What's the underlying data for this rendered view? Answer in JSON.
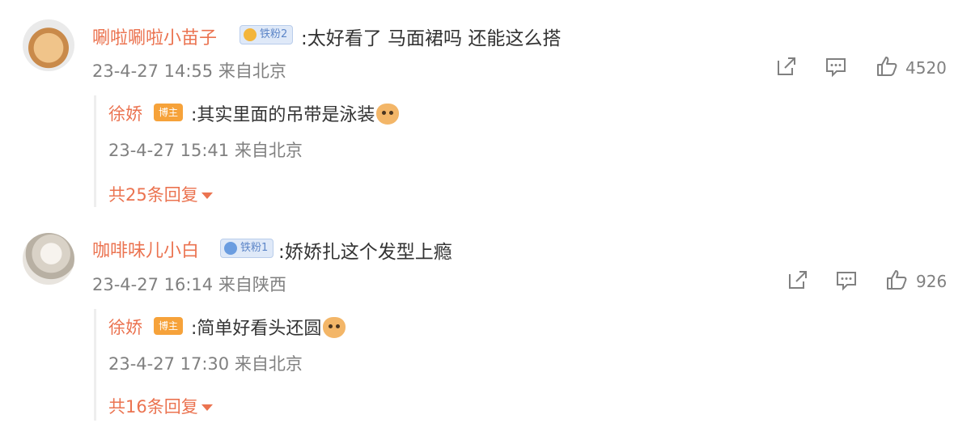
{
  "comments": [
    {
      "username": "唰啦唰啦小苗子",
      "badge": "铁粉2",
      "text": ":太好看了 马面裙吗  还能这么搭",
      "meta": "23-4-27 14:55 来自北京",
      "likes": "4520",
      "reply": {
        "username": "徐娇",
        "badge": "博主",
        "text": ":其实里面的吊带是泳装",
        "meta": "23-4-27 15:41 来自北京",
        "more": "共25条回复"
      }
    },
    {
      "username": "咖啡味儿小白",
      "badge": "铁粉1",
      "text": ":娇娇扎这个发型上瘾",
      "meta": "23-4-27 16:14 来自陕西",
      "likes": "926",
      "reply": {
        "username": "徐娇",
        "badge": "博主",
        "text": ":简单好看头还圆",
        "meta": "23-4-27 17:30 来自北京",
        "more": "共16条回复"
      }
    }
  ],
  "icons": [
    "share-icon",
    "comment-icon",
    "like-icon",
    "cat-emoji-icon",
    "dropdown-arrow-icon"
  ],
  "colors": {
    "username": "#eb7350",
    "meta": "#808080",
    "text": "#333333",
    "fan_badge": "#5d86c8",
    "owner_badge": "#f6a23a"
  }
}
